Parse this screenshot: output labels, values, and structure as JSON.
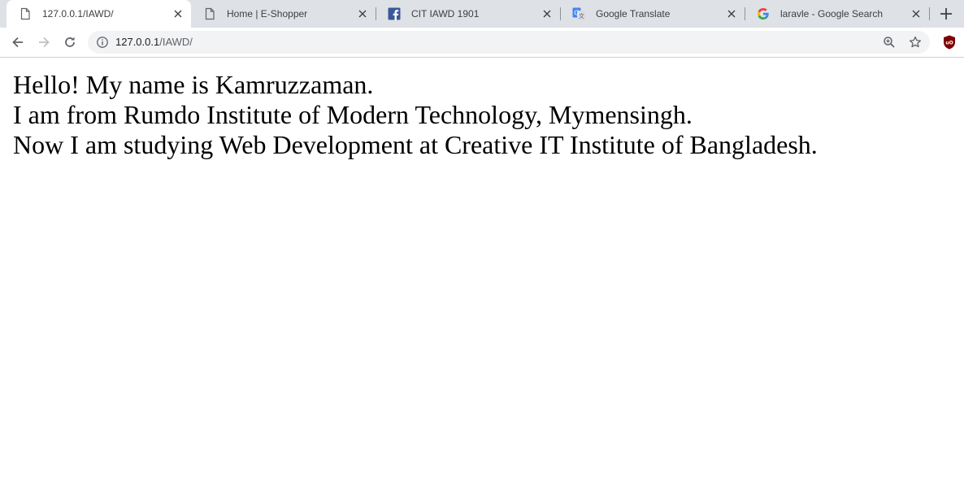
{
  "browser": {
    "tabs": [
      {
        "title": "127.0.0.1/IAWD/",
        "favicon": "page-icon",
        "active": true
      },
      {
        "title": "Home | E-Shopper",
        "favicon": "page-icon",
        "active": false
      },
      {
        "title": "CIT IAWD 1901",
        "favicon": "facebook-icon",
        "active": false
      },
      {
        "title": "Google Translate",
        "favicon": "google-translate-icon",
        "active": false
      },
      {
        "title": "laravle - Google Search",
        "favicon": "google-icon",
        "active": false
      }
    ],
    "address": {
      "host": "127.0.0.1",
      "path": "/IAWD/"
    },
    "colors": {
      "tabstrip": "#dee1e6",
      "omnibox": "#f1f3f4",
      "extension": "#800000"
    }
  },
  "page": {
    "lines": [
      "Hello! My name is Kamruzzaman.",
      "I am from Rumdo Institute of Modern Technology, Mymensingh.",
      "Now I am studying Web Development at Creative IT Institute of Bangladesh."
    ]
  }
}
